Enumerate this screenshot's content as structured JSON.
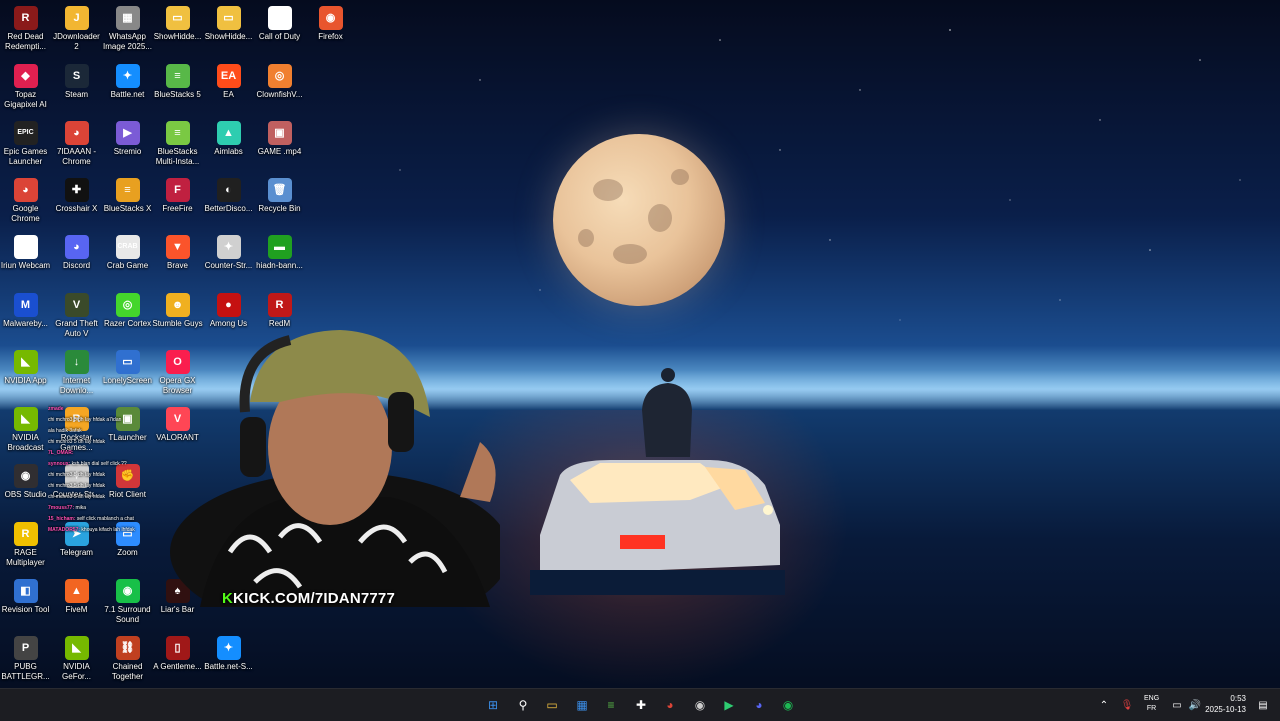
{
  "desktop_icons": [
    {
      "label": "Red Dead Redempti...",
      "glyph": "R",
      "color": "#8a1a1a"
    },
    {
      "label": "JDownloader 2",
      "glyph": "J",
      "color": "#f2b632"
    },
    {
      "label": "WhatsApp Image 2025...",
      "glyph": "▦",
      "color": "#888888"
    },
    {
      "label": "ShowHidde...",
      "glyph": "▭",
      "color": "#f0c040"
    },
    {
      "label": "ShowHidde...",
      "glyph": "▭",
      "color": "#f0c040"
    },
    {
      "label": "Call of Duty",
      "glyph": "▯",
      "color": "#ffffff"
    },
    {
      "label": "Firefox",
      "glyph": "◉",
      "color": "#e8552e"
    },
    {
      "label": "Topaz Gigapixel AI",
      "glyph": "◆",
      "color": "#e02050"
    },
    {
      "label": "Steam",
      "glyph": "S",
      "color": "#1b2838"
    },
    {
      "label": "Battle.net",
      "glyph": "✦",
      "color": "#148eff"
    },
    {
      "label": "BlueStacks 5",
      "glyph": "≡",
      "color": "#58b848"
    },
    {
      "label": "EA",
      "glyph": "EA",
      "color": "#ff4c1a"
    },
    {
      "label": "ClownfishV...",
      "glyph": "◎",
      "color": "#f08030"
    },
    {
      "label": "Epic Games Launcher",
      "glyph": "EPIC",
      "color": "#222222"
    },
    {
      "label": "7IDAAAN - Chrome",
      "glyph": "◕",
      "color": "#db4437"
    },
    {
      "label": "Stremio",
      "glyph": "▶",
      "color": "#7b5bd6"
    },
    {
      "label": "BlueStacks Multi-Insta...",
      "glyph": "≡",
      "color": "#7ac943"
    },
    {
      "label": "Aimlabs",
      "glyph": "▲",
      "color": "#2ecdb0"
    },
    {
      "label": "GAME .mp4",
      "glyph": "▣",
      "color": "#c06060"
    },
    {
      "label": "Google Chrome",
      "glyph": "◕",
      "color": "#db4437"
    },
    {
      "label": "Crosshair X",
      "glyph": "✚",
      "color": "#111111"
    },
    {
      "label": "BlueStacks X",
      "glyph": "≡",
      "color": "#e8a020"
    },
    {
      "label": "FreeFire",
      "glyph": "F",
      "color": "#c02040"
    },
    {
      "label": "BetterDisco...",
      "glyph": "◐",
      "color": "#202020"
    },
    {
      "label": "Recycle Bin",
      "glyph": "🗑",
      "color": "#5a8fd0"
    },
    {
      "label": "Iriun Webcam",
      "glyph": "◯",
      "color": "#ffffff"
    },
    {
      "label": "Discord",
      "glyph": "◕",
      "color": "#5865f2"
    },
    {
      "label": "Crab Game",
      "glyph": "CRAB",
      "color": "#e8e8e8"
    },
    {
      "label": "Brave",
      "glyph": "▼",
      "color": "#fb542b"
    },
    {
      "label": "Counter-Str...",
      "glyph": "✦",
      "color": "#d0d0d0"
    },
    {
      "label": "hiadn-bann...",
      "glyph": "▬",
      "color": "#20a020"
    },
    {
      "label": "Malwareby...",
      "glyph": "M",
      "color": "#1a4fd0"
    },
    {
      "label": "Grand Theft Auto V",
      "glyph": "V",
      "color": "#3a4a2a"
    },
    {
      "label": "Razer Cortex",
      "glyph": "◎",
      "color": "#44d62c"
    },
    {
      "label": "Stumble Guys",
      "glyph": "☻",
      "color": "#f0b020"
    },
    {
      "label": "Among Us",
      "glyph": "●",
      "color": "#c51111"
    },
    {
      "label": "RedM",
      "glyph": "R",
      "color": "#c01818"
    },
    {
      "label": "NVIDIA App",
      "glyph": "◣",
      "color": "#76b900"
    },
    {
      "label": "Internet Downlo...",
      "glyph": "↓",
      "color": "#2a8a3a"
    },
    {
      "label": "LonelyScreen",
      "glyph": "▭",
      "color": "#3070d0"
    },
    {
      "label": "Opera GX Browser",
      "glyph": "O",
      "color": "#fa1e4e"
    },
    {
      "label": "NVIDIA Broadcast",
      "glyph": "◣",
      "color": "#76b900"
    },
    {
      "label": "Rockstar Games...",
      "glyph": "R",
      "color": "#f5a623"
    },
    {
      "label": "TLauncher",
      "glyph": "▣",
      "color": "#5a8a3a"
    },
    {
      "label": "VALORANT",
      "glyph": "V",
      "color": "#ff4655"
    },
    {
      "label": "OBS Studio",
      "glyph": "◉",
      "color": "#302e31"
    },
    {
      "label": "Counter-Str...",
      "glyph": "✦",
      "color": "#d0d0d0"
    },
    {
      "label": "Riot Client",
      "glyph": "✊",
      "color": "#d13639"
    },
    {
      "label": "RAGE Multiplayer",
      "glyph": "R",
      "color": "#f0c000"
    },
    {
      "label": "Telegram",
      "glyph": "➤",
      "color": "#2aa3df"
    },
    {
      "label": "Zoom",
      "glyph": "▭",
      "color": "#2d8cff"
    },
    {
      "label": "Revision Tool",
      "glyph": "◧",
      "color": "#3070d0"
    },
    {
      "label": "FiveM",
      "glyph": "▲",
      "color": "#f26522"
    },
    {
      "label": "7.1 Surround Sound",
      "glyph": "◉",
      "color": "#18c048"
    },
    {
      "label": "Liar's Bar",
      "glyph": "♠",
      "color": "#301010"
    },
    {
      "label": "PUBG BATTLEGR...",
      "glyph": "P",
      "color": "#444444"
    },
    {
      "label": "NVIDIA GeFor...",
      "glyph": "◣",
      "color": "#76b900"
    },
    {
      "label": "Chained Together",
      "glyph": "⛓",
      "color": "#c04020"
    },
    {
      "label": "A Gentleme...",
      "glyph": "▯",
      "color": "#a01818"
    },
    {
      "label": "Battle.net-S...",
      "glyph": "✦",
      "color": "#148eff"
    }
  ],
  "overlay": {
    "kick_prefix": "K",
    "kick_text": "KICK.COM/7IDAN7777"
  },
  "chat": [
    {
      "user": "zmade",
      "text": ""
    },
    {
      "user": "",
      "text": "chi mchro3 5 dh lay hfdak a7idan"
    },
    {
      "user": "",
      "text": "ala hadik 3afak"
    },
    {
      "user": "",
      "text": "chi mchro3 5 dh lay hfdak"
    },
    {
      "user": "7L_OMAR:",
      "text": ""
    },
    {
      "user": "synnoux:",
      "text": "ksh blan dial self click ??"
    },
    {
      "user": "",
      "text": "chi mchro3 5 dh lay hfdak"
    },
    {
      "user": "",
      "text": "chi mchro3 5 dh lay hfdak"
    },
    {
      "user": "",
      "text": "chi mchro3 5 dh lay hfdak"
    },
    {
      "user": "7mouss77:",
      "text": "mika"
    },
    {
      "user": "",
      "text": ""
    },
    {
      "user": "15_hicham:",
      "text": "self click mablanch a chat"
    },
    {
      "user": "MATADOR57:",
      "text": "khouya kifach lah lhfdak"
    }
  ],
  "taskbar": {
    "icons": [
      {
        "name": "start-icon",
        "glyph": "⊞",
        "color": "#3b8ee8"
      },
      {
        "name": "search-icon",
        "glyph": "⚲",
        "color": "#ffffff"
      },
      {
        "name": "file-explorer-icon",
        "glyph": "▭",
        "color": "#f0c040"
      },
      {
        "name": "store-icon",
        "glyph": "▦",
        "color": "#3b8ee8"
      },
      {
        "name": "bluestacks-icon",
        "glyph": "≡",
        "color": "#58b848"
      },
      {
        "name": "crosshair-icon",
        "glyph": "✚",
        "color": "#ffffff"
      },
      {
        "name": "chrome-icon",
        "glyph": "◕",
        "color": "#db4437"
      },
      {
        "name": "obs-icon",
        "glyph": "◉",
        "color": "#cccccc"
      },
      {
        "name": "bluestacks-play-icon",
        "glyph": "▶",
        "color": "#2ecc71"
      },
      {
        "name": "discord-icon",
        "glyph": "◕",
        "color": "#5865f2"
      },
      {
        "name": "spotify-icon",
        "glyph": "◉",
        "color": "#1db954"
      }
    ],
    "lang_top": "ENG",
    "lang_bottom": "FR",
    "time": "0:53",
    "date": "2025-10-13"
  }
}
